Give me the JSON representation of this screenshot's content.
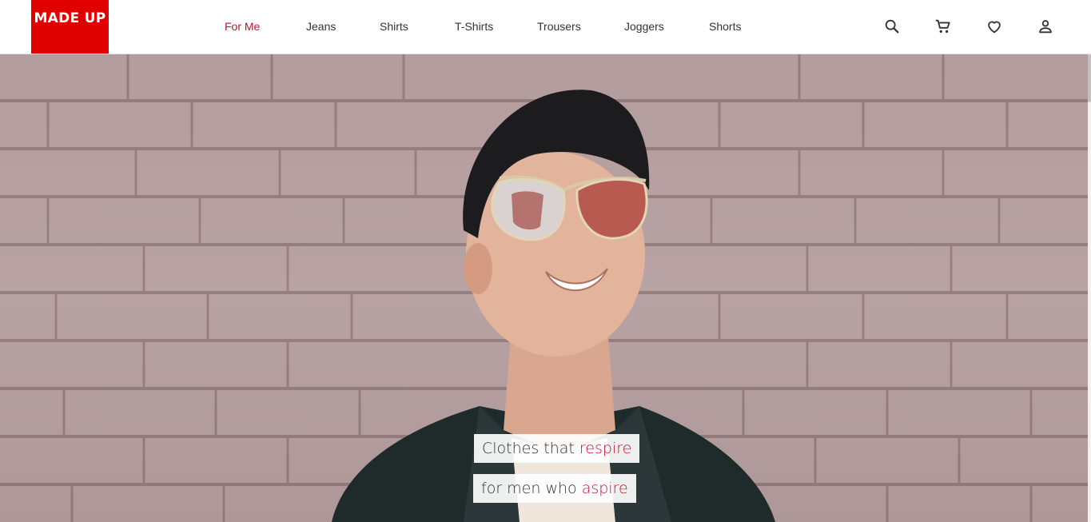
{
  "brand": {
    "logo_text": "MADE UP",
    "accent_color": "#e00000",
    "highlight_color": "#c8102e"
  },
  "nav": {
    "items": [
      {
        "label": "For Me",
        "active": true
      },
      {
        "label": "Jeans",
        "active": false
      },
      {
        "label": "Shirts",
        "active": false
      },
      {
        "label": "T-Shirts",
        "active": false
      },
      {
        "label": "Trousers",
        "active": false
      },
      {
        "label": "Joggers",
        "active": false
      },
      {
        "label": "Shorts",
        "active": false
      }
    ]
  },
  "header_icons": [
    "search-icon",
    "cart-icon",
    "heart-icon",
    "user-icon"
  ],
  "hero": {
    "line1_prefix": "Clothes that ",
    "line1_highlight": "respire",
    "line2_prefix": "for men who ",
    "line2_highlight": "aspire"
  }
}
